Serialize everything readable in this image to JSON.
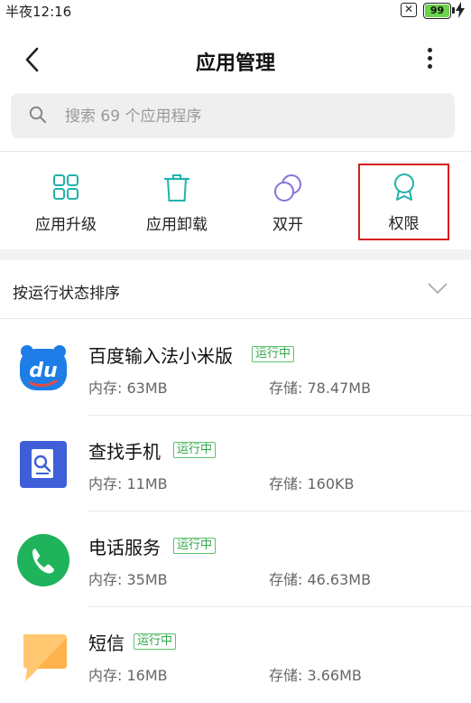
{
  "status_bar": {
    "time": "半夜12:16",
    "battery_level": "99"
  },
  "header": {
    "title": "应用管理"
  },
  "search": {
    "placeholder": "搜索 69 个应用程序"
  },
  "actions": [
    {
      "label": "应用升级",
      "icon": "grid-icon"
    },
    {
      "label": "应用卸载",
      "icon": "trash-icon"
    },
    {
      "label": "双开",
      "icon": "dual-circle-icon"
    },
    {
      "label": "权限",
      "icon": "ribbon-icon"
    }
  ],
  "sort": {
    "label": "按运行状态排序"
  },
  "apps": [
    {
      "name": "百度输入法小米版",
      "status": "运行中",
      "memory": "内存: 63MB",
      "storage": "存储: 78.47MB",
      "icon": "baidu-du-icon"
    },
    {
      "name": "查找手机",
      "status": "运行中",
      "memory": "内存: 11MB",
      "storage": "存储: 160KB",
      "icon": "find-phone-icon"
    },
    {
      "name": "电话服务",
      "status": "运行中",
      "memory": "内存: 35MB",
      "storage": "存储: 46.63MB",
      "icon": "phone-icon"
    },
    {
      "name": "短信",
      "status": "运行中",
      "memory": "内存: 16MB",
      "storage": "存储: 3.66MB",
      "icon": "messages-icon"
    }
  ],
  "colors": {
    "accent_teal": "#1fb3a9",
    "running_green": "#2fa84a",
    "highlight_red": "#d81e1e"
  }
}
